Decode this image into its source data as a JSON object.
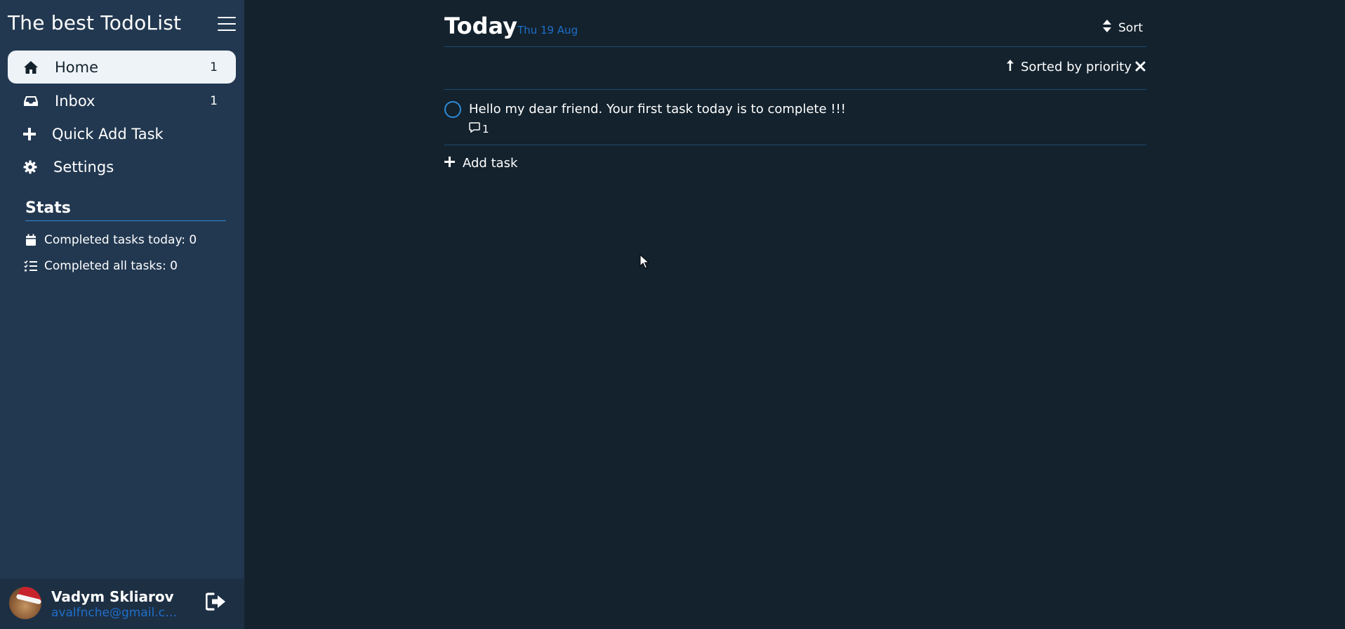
{
  "app": {
    "title": "The best TodoList"
  },
  "sidebar": {
    "items": [
      {
        "label": "Home",
        "count": "1",
        "icon": "home-icon"
      },
      {
        "label": "Inbox",
        "count": "1",
        "icon": "inbox-icon"
      },
      {
        "label": "Quick Add Task",
        "count": "",
        "icon": "plus-icon"
      },
      {
        "label": "Settings",
        "count": "",
        "icon": "gear-icon"
      }
    ],
    "stats": {
      "title": "Stats",
      "today": "Completed tasks today: 0",
      "all": "Completed all tasks: 0"
    },
    "user": {
      "name": "Vadym Skliarov",
      "email": "avalfnche@gmail.com"
    }
  },
  "main": {
    "title": "Today",
    "date": "Thu 19 Aug",
    "sort_label": "Sort",
    "sorted_by": "Sorted by priority",
    "tasks": [
      {
        "text": "Hello my dear friend. Your first task today is to complete !!!",
        "comments": "1"
      }
    ],
    "add_task_label": "Add task"
  },
  "colors": {
    "background": "#13222d",
    "sidebar": "#223850",
    "accent": "#2f8ad9",
    "link": "#1f6fc9",
    "divider": "#1f4a72"
  }
}
